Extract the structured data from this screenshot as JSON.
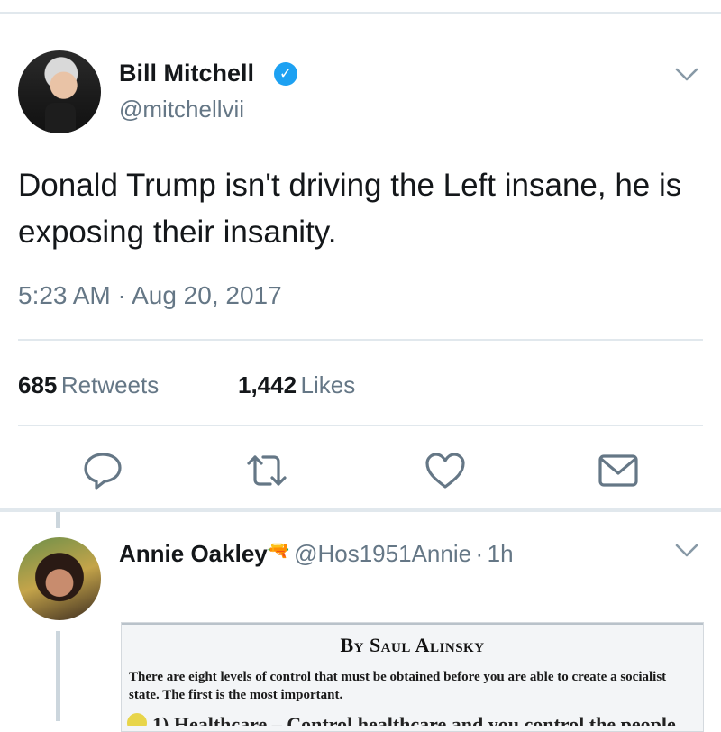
{
  "tweet": {
    "author_name": "Bill Mitchell",
    "author_handle": "@mitchellvii",
    "text": "Donald Trump isn't driving the Left insane, he is exposing their insanity.",
    "timestamp": "5:23 AM · Aug 20, 2017",
    "retweets_count": "685",
    "retweets_label": "Retweets",
    "likes_count": "1,442",
    "likes_label": "Likes",
    "verified_icon": "verified-badge-icon",
    "verified_mark": "✓"
  },
  "reply": {
    "author_name": "Annie Oakley",
    "author_emoji": "🔫",
    "author_handle": "@Hos1951Annie",
    "separator": "·",
    "time": "1h",
    "document": {
      "title": "By Saul Alinsky",
      "body": "There are eight levels of control that must be obtained before you are able to create a socialist state. The first is the most important.",
      "partial_line": "1) Healthcare – Control healthcare and you control the people"
    }
  },
  "actions": [
    "reply-icon",
    "retweet-icon",
    "like-icon",
    "direct-message-icon"
  ],
  "colors": {
    "accent": "#1da1f2",
    "secondary_text": "#657786",
    "divider": "#e1e8ed",
    "icon": "#657786"
  }
}
